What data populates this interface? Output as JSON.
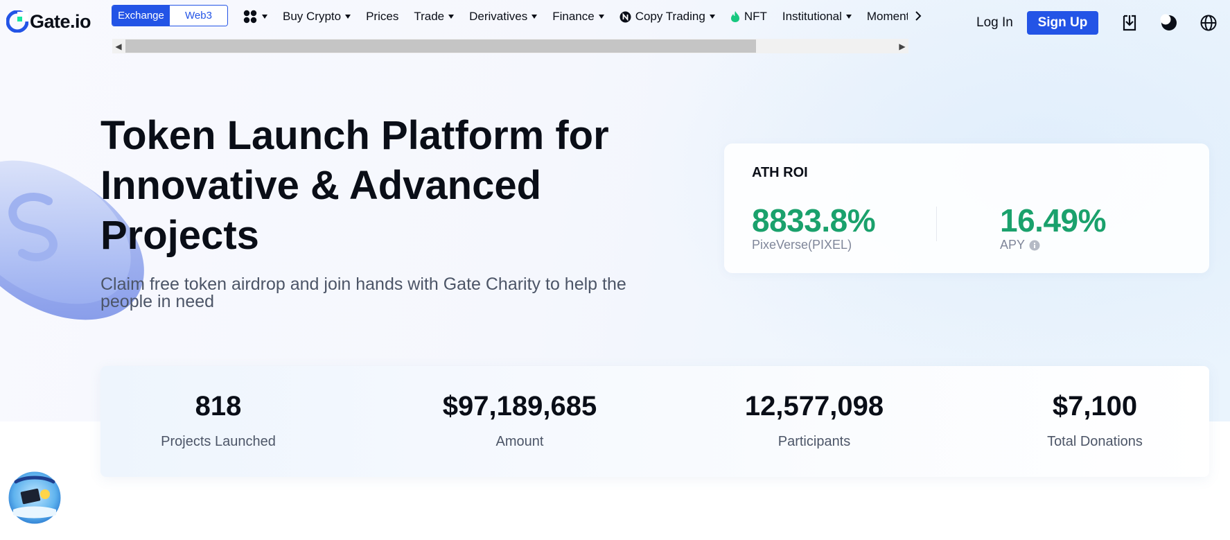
{
  "brand": {
    "logo_text": "Gate.io",
    "accent": "#2354e6",
    "positive": "#1aa16c"
  },
  "header": {
    "switch": {
      "exchange_label": "Exchange",
      "web3_label": "Web3"
    },
    "nav": [
      {
        "label": "Buy Crypto",
        "dropdown": true
      },
      {
        "label": "Prices",
        "dropdown": false
      },
      {
        "label": "Trade",
        "dropdown": true
      },
      {
        "label": "Derivatives",
        "dropdown": true
      },
      {
        "label": "Finance",
        "dropdown": true
      },
      {
        "label": "Copy Trading",
        "dropdown": true,
        "icon": "copy-trading-icon"
      },
      {
        "label": "NFT",
        "dropdown": false,
        "icon": "nft-flame-icon"
      },
      {
        "label": "Institutional",
        "dropdown": true
      },
      {
        "label": "Moments",
        "dropdown": false
      }
    ],
    "login_label": "Log In",
    "signup_label": "Sign Up",
    "icons": [
      "download-icon",
      "theme-toggle-icon",
      "language-globe-icon"
    ]
  },
  "hero": {
    "title_lines": [
      "Token Launch Platform for",
      "Innovative & Advanced",
      "Projects"
    ],
    "subtitle": "Claim free token airdrop and join hands with Gate Charity to help the people in need"
  },
  "roi_card": {
    "title": "ATH ROI",
    "left": {
      "value": "8833.8%",
      "label": "PixeVerse(PIXEL)"
    },
    "right": {
      "value": "16.49%",
      "label": "APY"
    }
  },
  "stats": [
    {
      "value": "818",
      "label": "Projects Launched"
    },
    {
      "value": "$97,189,685",
      "label": "Amount"
    },
    {
      "value": "12,577,098",
      "label": "Participants"
    },
    {
      "value": "$7,100",
      "label": "Total Donations"
    }
  ]
}
